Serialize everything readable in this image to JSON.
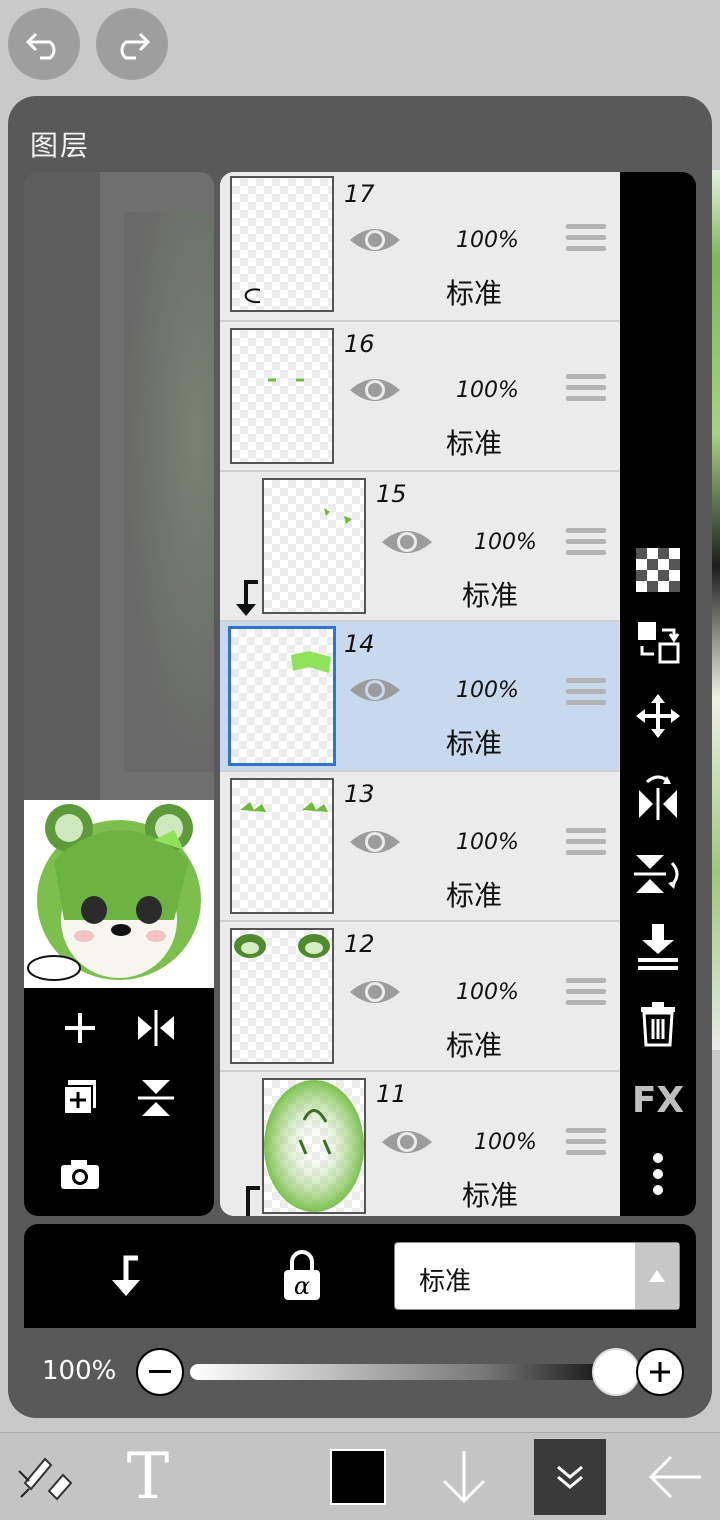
{
  "panel": {
    "title": "图层"
  },
  "layers": [
    {
      "number": "17",
      "opacity": "100%",
      "mode": "标准",
      "selected": false,
      "clipped": false
    },
    {
      "number": "16",
      "opacity": "100%",
      "mode": "标准",
      "selected": false,
      "clipped": false
    },
    {
      "number": "15",
      "opacity": "100%",
      "mode": "标准",
      "selected": false,
      "clipped": true
    },
    {
      "number": "14",
      "opacity": "100%",
      "mode": "标准",
      "selected": true,
      "clipped": false
    },
    {
      "number": "13",
      "opacity": "100%",
      "mode": "标准",
      "selected": false,
      "clipped": false
    },
    {
      "number": "12",
      "opacity": "100%",
      "mode": "标准",
      "selected": false,
      "clipped": false
    },
    {
      "number": "11",
      "opacity": "100%",
      "mode": "标准",
      "selected": false,
      "clipped": true
    }
  ],
  "blend_mode": {
    "value": "标准"
  },
  "opacity_control": {
    "label": "100%",
    "value_percent": 100
  },
  "right_tools": {
    "fx_label": "FX"
  },
  "bottom_toolbar": {
    "text_tool_label": "T",
    "current_color": "#000000"
  },
  "colors": {
    "selection": "#2f74d0",
    "selected_row": "#c8d9ee",
    "accent_green": "#6dbb3a"
  }
}
